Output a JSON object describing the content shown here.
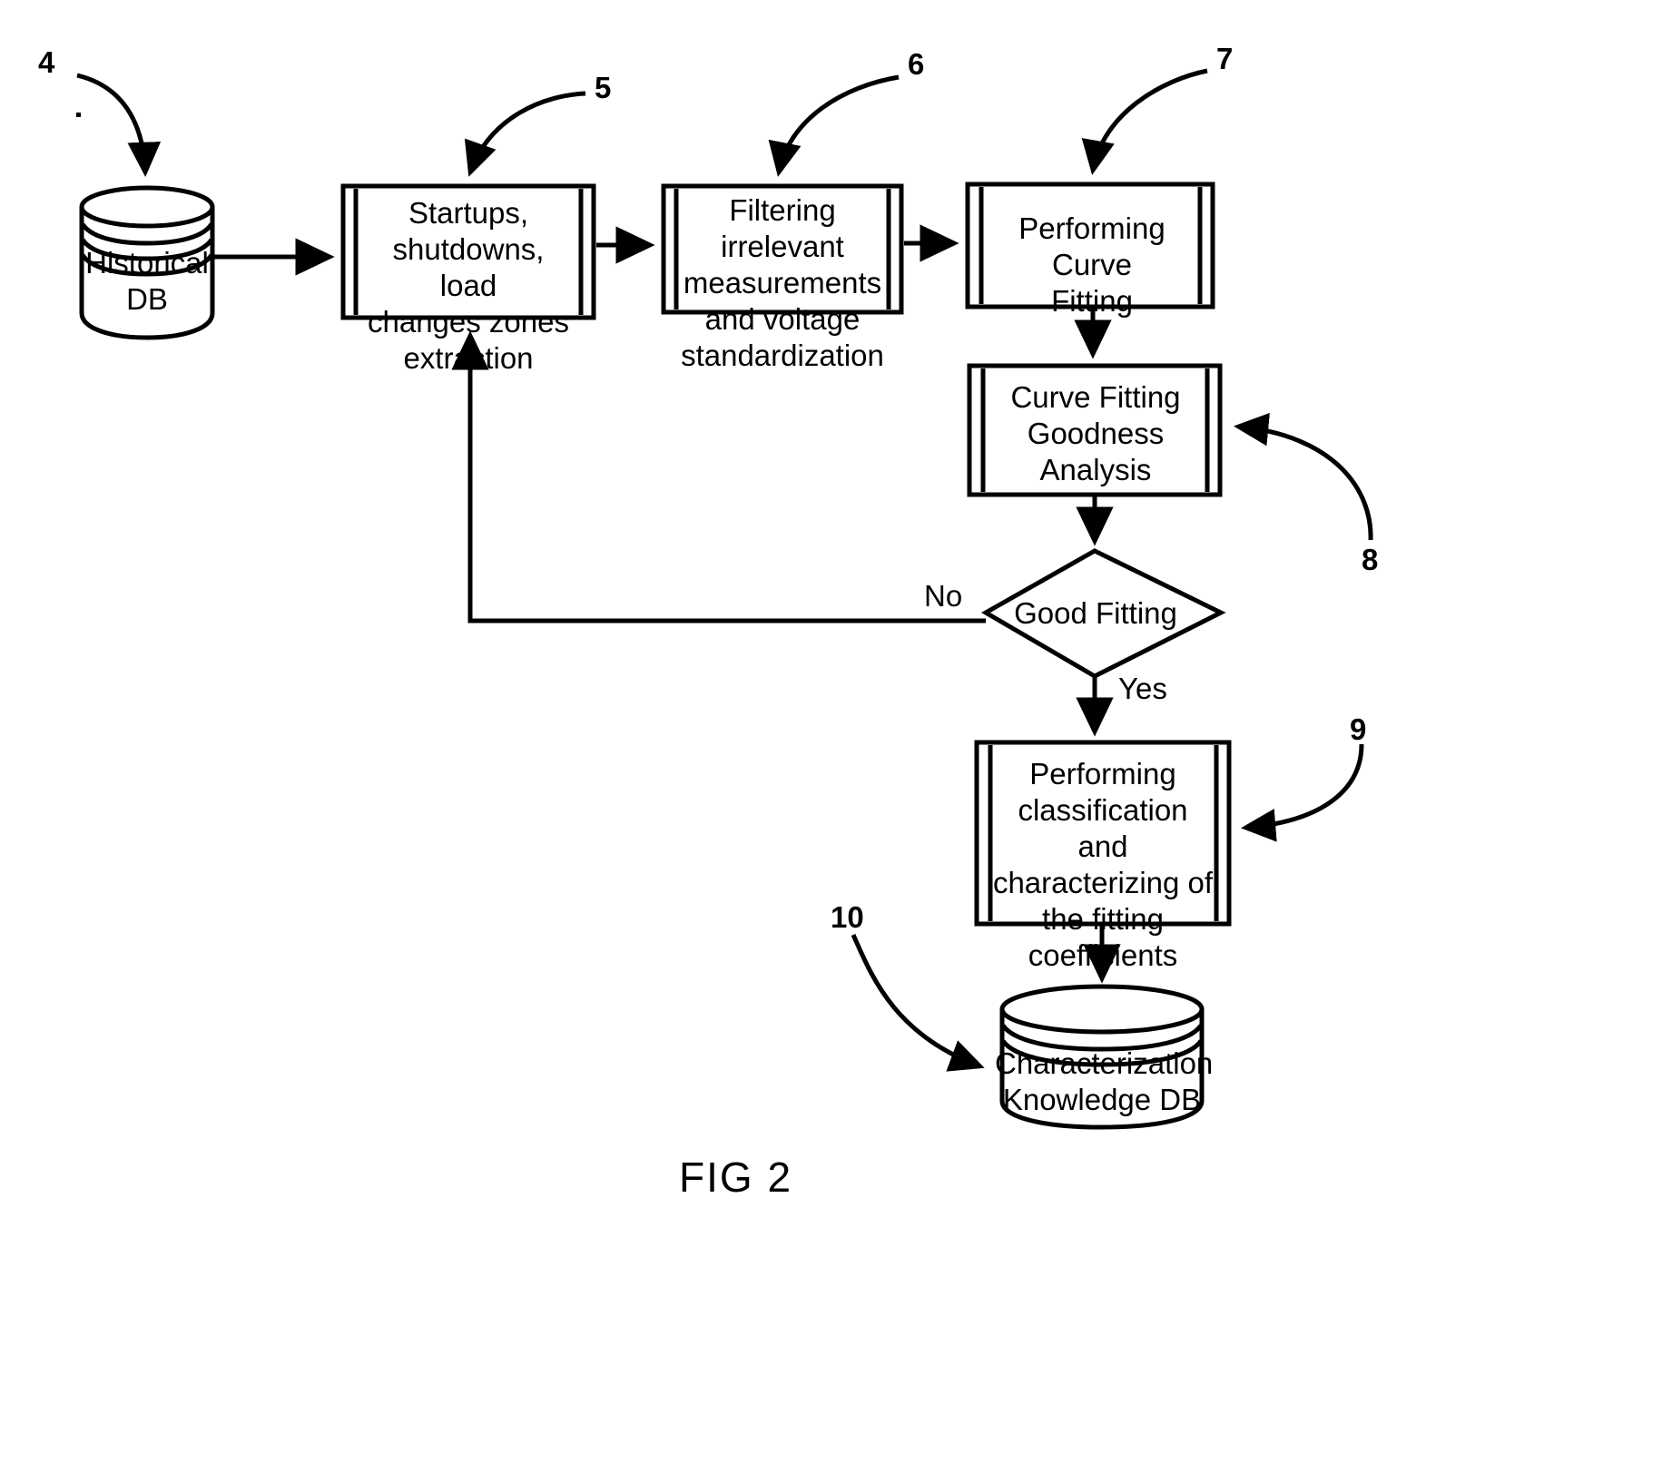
{
  "figure": {
    "caption": "FIG 2",
    "type": "flowchart",
    "title": ""
  },
  "nodes": [
    {
      "id": "historical-db",
      "shape": "database-cylinder",
      "label": "Historical\nDB",
      "ref": "4"
    },
    {
      "id": "zones-extraction",
      "shape": "predefined-process",
      "label": "Startups,\nshutdowns, load\nchanges zones\nextraction",
      "ref": "5"
    },
    {
      "id": "filtering",
      "shape": "predefined-process",
      "label": "Filtering irrelevant\nmeasurements\nand voltage\nstandardization",
      "ref": "6"
    },
    {
      "id": "curve-fitting",
      "shape": "predefined-process",
      "label": "Performing Curve\nFitting",
      "ref": "7"
    },
    {
      "id": "goodness-analysis",
      "shape": "predefined-process",
      "label": "Curve Fitting\nGoodness\nAnalysis",
      "ref": "8"
    },
    {
      "id": "good-fitting-decision",
      "shape": "diamond",
      "label": "Good Fitting",
      "ref": ""
    },
    {
      "id": "classification",
      "shape": "predefined-process",
      "label": "Performing\nclassification and\ncharacterizing of\nthe fitting\ncoefficients",
      "ref": "9"
    },
    {
      "id": "knowledge-db",
      "shape": "database-cylinder",
      "label": "Characterization\nKnowledge DB",
      "ref": "10"
    }
  ],
  "edge_labels": {
    "no": "No",
    "yes": "Yes"
  },
  "reference_numerals": {
    "n4": "4",
    "n5": "5",
    "n6": "6",
    "n7": "7",
    "n8": "8",
    "n9": "9",
    "n10": "10"
  },
  "colors": {
    "stroke": "#000000",
    "background": "#ffffff",
    "text": "#000000"
  }
}
